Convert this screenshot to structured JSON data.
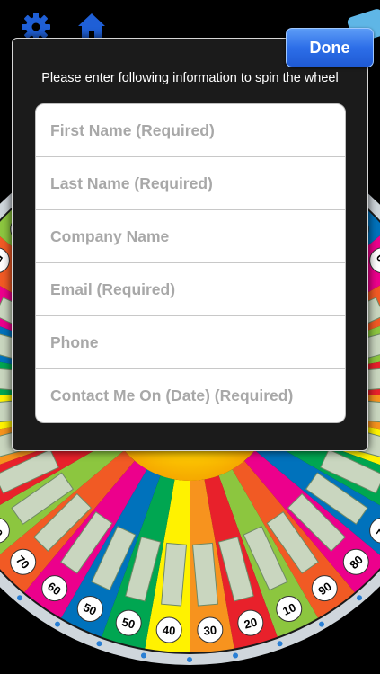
{
  "header": {
    "settings_icon": "gear-icon",
    "home_icon": "home-icon"
  },
  "modal": {
    "done_label": "Done",
    "instruction": "Please enter following information to spin the wheel",
    "fields": [
      {
        "placeholder": "First Name (Required)",
        "value": ""
      },
      {
        "placeholder": "Last Name (Required)",
        "value": ""
      },
      {
        "placeholder": "Company Name",
        "value": ""
      },
      {
        "placeholder": "Email (Required)",
        "value": ""
      },
      {
        "placeholder": "Phone",
        "value": ""
      },
      {
        "placeholder": "Contact Me On (Date) (Required)",
        "value": ""
      }
    ]
  },
  "wheel": {
    "visible_numbers": [
      "50",
      "60",
      "70",
      "80",
      "90",
      "10",
      "20",
      "30",
      "40",
      "50"
    ],
    "segment_colors": [
      "#e8212b",
      "#f7931e",
      "#fff200",
      "#00a651",
      "#0072bc",
      "#ec008c",
      "#f15a24",
      "#8cc63f"
    ],
    "hub_color": "#ffcc00"
  }
}
